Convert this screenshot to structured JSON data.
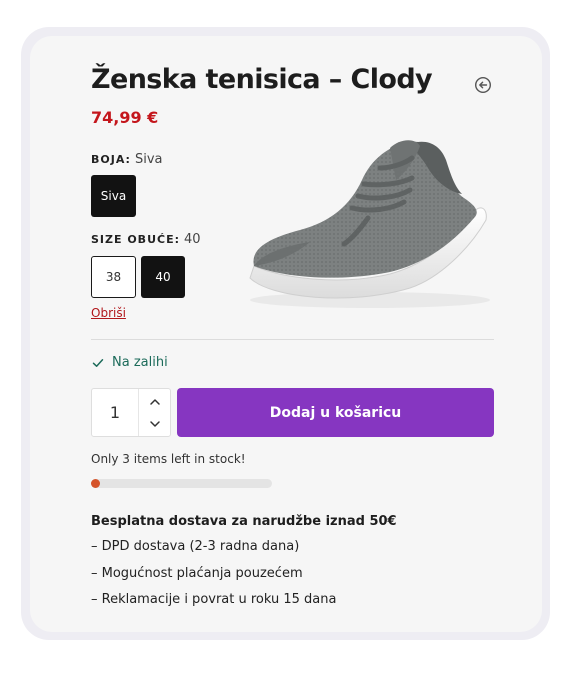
{
  "product": {
    "title": "Ženska tenisica – Clody",
    "price": "74,99 €"
  },
  "attributes": {
    "color": {
      "label": "BOJA:",
      "selected": "Siva",
      "options": [
        "Siva"
      ]
    },
    "size": {
      "label": "SIZE OBUĆE:",
      "selected": "40",
      "options": [
        "38",
        "40"
      ]
    },
    "clear_label": "Obriši"
  },
  "stock": {
    "status": "Na zalihi",
    "left_text": "Only 3 items left in stock!",
    "progress_fraction": 0.04
  },
  "cart": {
    "quantity": "1",
    "add_label": "Dodaj u košaricu"
  },
  "shipping": {
    "title": "Besplatna dostava za narudžbe iznad 50€",
    "items": [
      "– DPD dostava (2-3 radna dana)",
      "– Mogućnost plaćanja pouzećem",
      "– Reklamacije i povrat u roku 15 dana"
    ]
  },
  "icons": {
    "back": "circle-arrow-left-icon",
    "check": "check-icon",
    "qty_up": "chevron-up-icon",
    "qty_down": "chevron-down-icon"
  },
  "colors": {
    "price": "#c4161c",
    "accent": "#8636c1",
    "stock": "#1c6b5a",
    "progress": "#d5542a",
    "link": "#b1171b"
  }
}
